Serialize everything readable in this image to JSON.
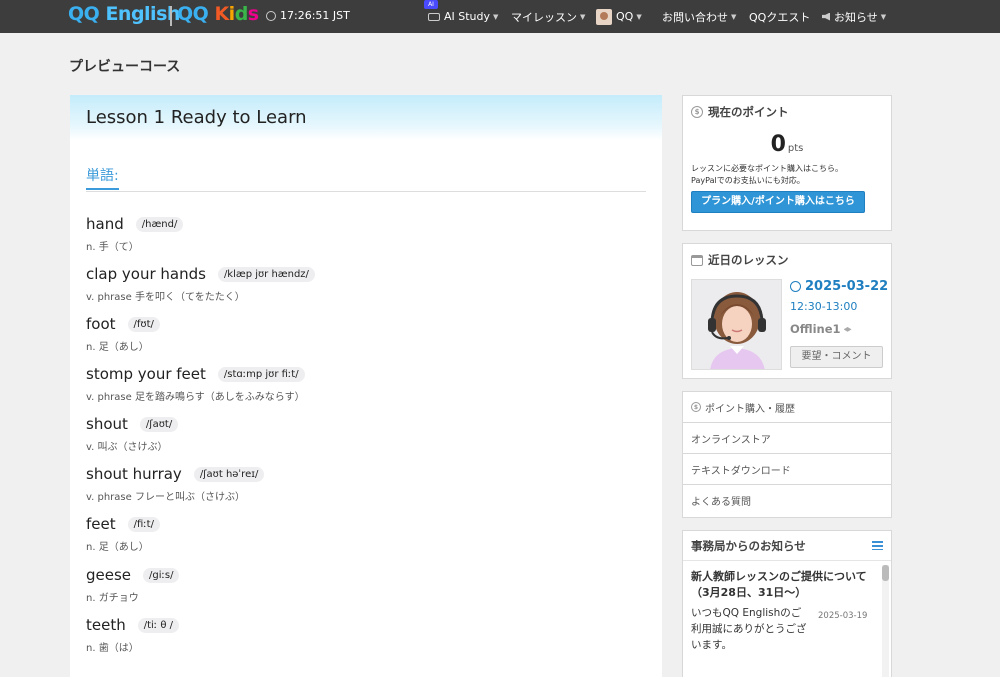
{
  "header": {
    "logo_qq": "QQ",
    "logo_english": "English",
    "logo_kids_qq": "QQ",
    "logo_kids_word": "Kids",
    "clock": "17:26:51 JST",
    "ai_badge": "AI",
    "nav": {
      "ai_study": "AI Study",
      "my_lesson": "マイレッスン",
      "user": "QQ",
      "contact": "お問い合わせ",
      "quest": "QQクエスト",
      "notices": "お知らせ"
    }
  },
  "page": {
    "title": "プレビューコース"
  },
  "lesson": {
    "title": "Lesson 1 Ready to Learn",
    "vocab_label": "単語:",
    "words": [
      {
        "word": "hand",
        "phonetic": "/hænd/",
        "definition": "n. 手（て）"
      },
      {
        "word": "clap your hands",
        "phonetic": "/klæp jʊr hændz/",
        "definition": "v. phrase 手を叩く（てをたたく）"
      },
      {
        "word": "foot",
        "phonetic": "/fʊt/",
        "definition": "n. 足（あし）"
      },
      {
        "word": "stomp your feet",
        "phonetic": "/stɑːmp jʊr fiːt/",
        "definition": "v. phrase 足を踏み鳴らす（あしをふみならす）"
      },
      {
        "word": "shout",
        "phonetic": "/ʃaʊt/",
        "definition": "v. 叫ぶ（さけぶ）"
      },
      {
        "word": "shout hurray",
        "phonetic": "/ʃaʊt həˈreɪ/",
        "definition": "v. phrase フレーと叫ぶ（さけぶ）"
      },
      {
        "word": "feet",
        "phonetic": "/fiːt/",
        "definition": "n. 足（あし）"
      },
      {
        "word": "geese",
        "phonetic": "/giːs/",
        "definition": "n. ガチョウ"
      },
      {
        "word": "teeth",
        "phonetic": "/tiː θ /",
        "definition": "n. 歯（は）"
      }
    ]
  },
  "points": {
    "heading": "現在のポイント",
    "value": "0",
    "unit": "pts",
    "note_1": "レッスンに必要なポイント購入はこちら。",
    "note_2": "PayPalでのお支払いにも対応。",
    "button": "プラン購入/ポイント購入はこちら"
  },
  "upcoming": {
    "heading": "近日のレッスン",
    "date": "2025-03-22",
    "time": "12:30-13:00",
    "tutor": "Offline1",
    "request_button": "要望・コメント"
  },
  "menu": [
    {
      "label": "ポイント購入・履歴",
      "icon": "coin-icon"
    },
    {
      "label": "オンラインストア"
    },
    {
      "label": "テキストダウンロード"
    },
    {
      "label": "よくある質問"
    }
  ],
  "notices": {
    "heading": "事務局からのお知らせ",
    "item_title": "新人教師レッスンのご提供について（3月28日、31日〜）",
    "item_text": "いつもQQ Englishのご利用誠にありがとうございます。",
    "item_date": "2025-03-19"
  }
}
